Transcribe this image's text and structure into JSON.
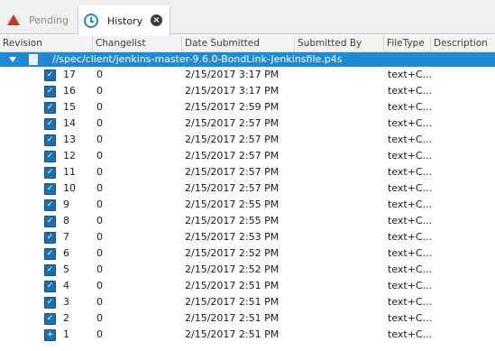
{
  "tabs": {
    "pending": "Pending",
    "history": "History"
  },
  "columns": [
    "Revision",
    "Changelist",
    "Date Submitted",
    "Submitted By",
    "FileType",
    "Description"
  ],
  "depot_path": "//spec/client/jenkins-master-9.6.0-BondLink-Jenkinsfile.p4s",
  "rows": [
    {
      "revision": "17",
      "changelist": "0",
      "date": "2/15/2017 3:17 PM",
      "filetype": "text+C..."
    },
    {
      "revision": "16",
      "changelist": "0",
      "date": "2/15/2017 3:17 PM",
      "filetype": "text+C..."
    },
    {
      "revision": "15",
      "changelist": "0",
      "date": "2/15/2017 2:59 PM",
      "filetype": "text+C..."
    },
    {
      "revision": "14",
      "changelist": "0",
      "date": "2/15/2017 2:57 PM",
      "filetype": "text+C..."
    },
    {
      "revision": "13",
      "changelist": "0",
      "date": "2/15/2017 2:57 PM",
      "filetype": "text+C..."
    },
    {
      "revision": "12",
      "changelist": "0",
      "date": "2/15/2017 2:57 PM",
      "filetype": "text+C..."
    },
    {
      "revision": "11",
      "changelist": "0",
      "date": "2/15/2017 2:57 PM",
      "filetype": "text+C..."
    },
    {
      "revision": "10",
      "changelist": "0",
      "date": "2/15/2017 2:57 PM",
      "filetype": "text+C..."
    },
    {
      "revision": "9",
      "changelist": "0",
      "date": "2/15/2017 2:55 PM",
      "filetype": "text+C..."
    },
    {
      "revision": "8",
      "changelist": "0",
      "date": "2/15/2017 2:55 PM",
      "filetype": "text+C..."
    },
    {
      "revision": "7",
      "changelist": "0",
      "date": "2/15/2017 2:53 PM",
      "filetype": "text+C..."
    },
    {
      "revision": "6",
      "changelist": "0",
      "date": "2/15/2017 2:52 PM",
      "filetype": "text+C..."
    },
    {
      "revision": "5",
      "changelist": "0",
      "date": "2/15/2017 2:52 PM",
      "filetype": "text+C..."
    },
    {
      "revision": "4",
      "changelist": "0",
      "date": "2/15/2017 2:51 PM",
      "filetype": "text+C..."
    },
    {
      "revision": "3",
      "changelist": "0",
      "date": "2/15/2017 2:51 PM",
      "filetype": "text+C..."
    },
    {
      "revision": "2",
      "changelist": "0",
      "date": "2/15/2017 2:51 PM",
      "filetype": "text+C..."
    },
    {
      "revision": "1",
      "changelist": "0",
      "date": "2/15/2017 2:51 PM",
      "filetype": "text+C..."
    }
  ],
  "colors": {
    "accent": "#1e8ad6",
    "pending_icon": "#c0392b"
  }
}
